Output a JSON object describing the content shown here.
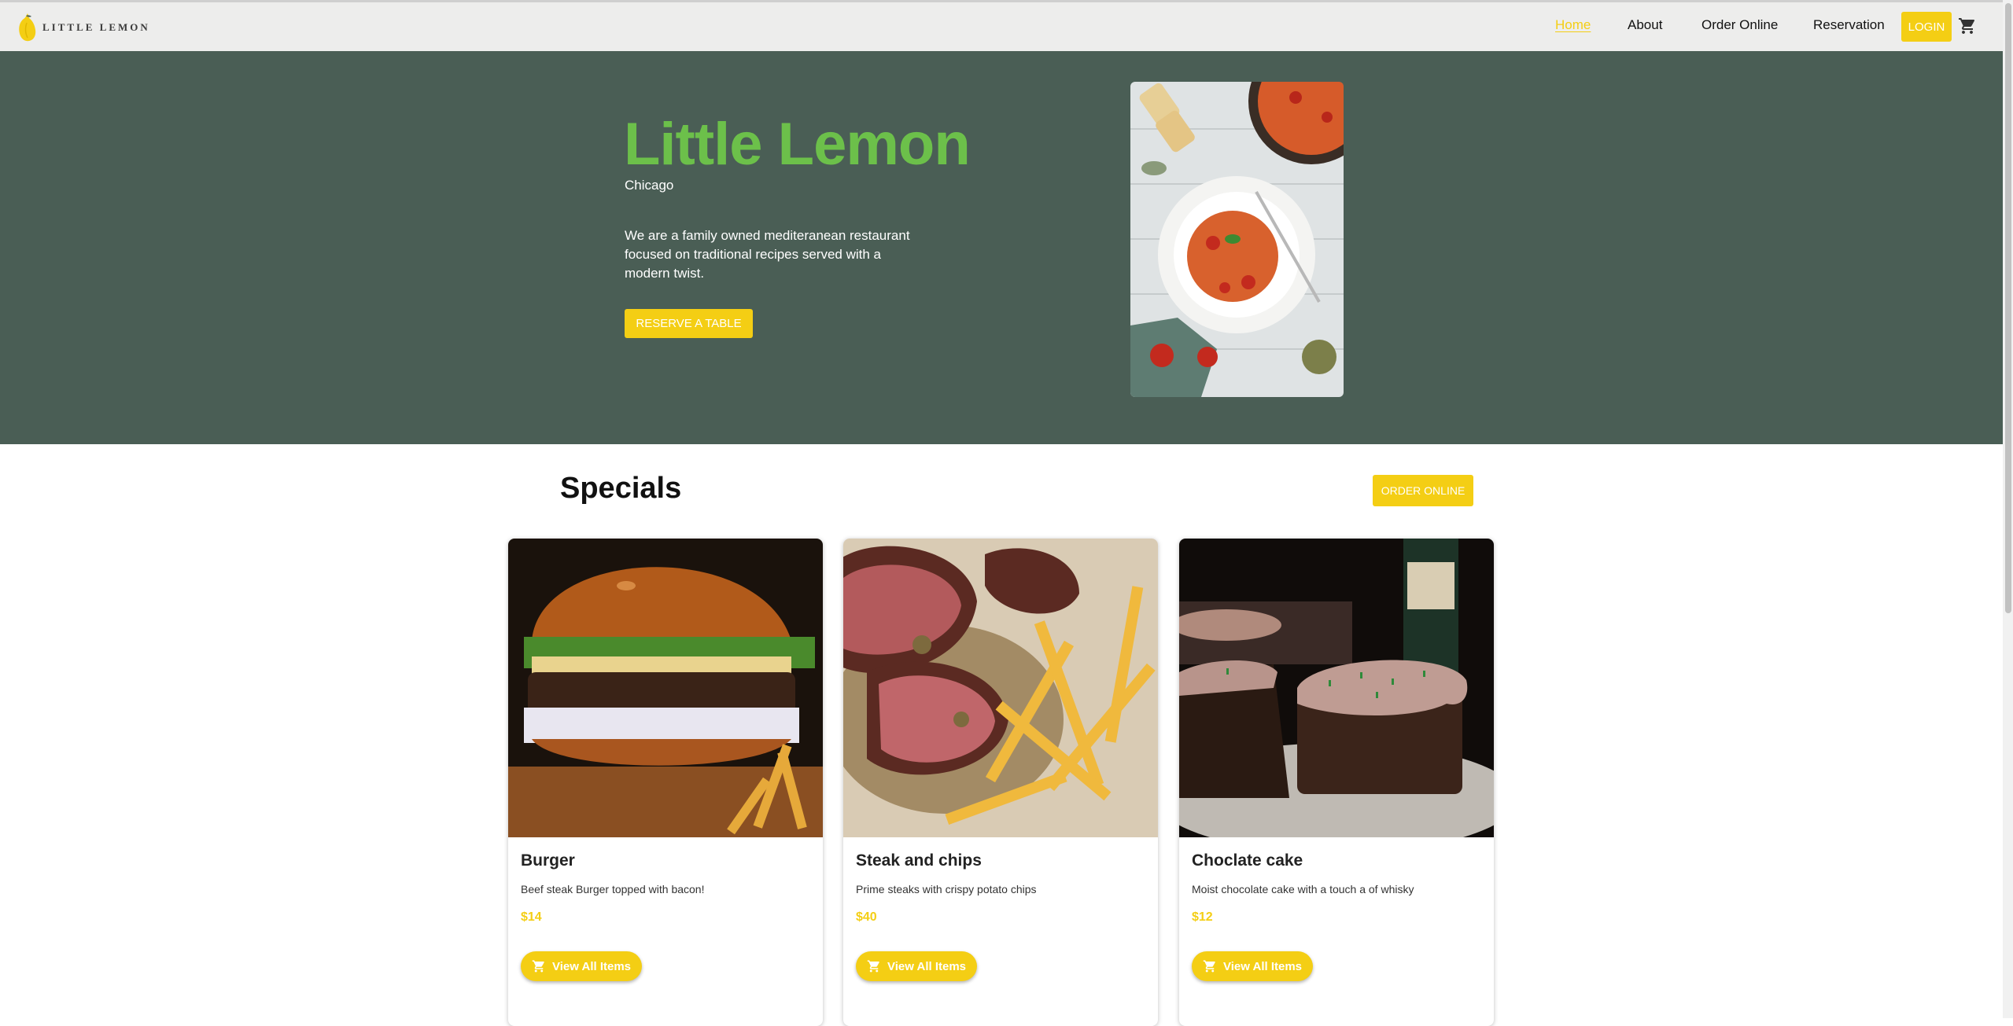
{
  "brand": {
    "logo_text": "LITTLE LEMON",
    "accent": "#f4ce14",
    "hero_bg": "#4a5e55",
    "title_green": "#6cc04a"
  },
  "nav": {
    "items": [
      {
        "label": "Home",
        "active": true
      },
      {
        "label": "About",
        "active": false
      },
      {
        "label": "Order Online",
        "active": false
      },
      {
        "label": "Reservation",
        "active": false
      }
    ],
    "login_label": "LOGIN",
    "cart_icon": "shopping-cart-icon"
  },
  "hero": {
    "title": "Little Lemon",
    "city": "Chicago",
    "description": "We are a family owned mediteranean restaurant focused on traditional recipes served with a modern twist.",
    "reserve_label": "RESERVE A TABLE"
  },
  "specials": {
    "title": "Specials",
    "order_online_label": "ORDER ONLINE",
    "items": [
      {
        "name": "Burger",
        "description": "Beef steak Burger topped with bacon!",
        "price": "$14",
        "button_label": "View All Items"
      },
      {
        "name": "Steak and chips",
        "description": "Prime steaks with crispy potato chips",
        "price": "$40",
        "button_label": "View All Items"
      },
      {
        "name": "Choclate cake",
        "description": "Moist chocolate cake with a touch a of whisky",
        "price": "$12",
        "button_label": "View All Items"
      }
    ]
  }
}
